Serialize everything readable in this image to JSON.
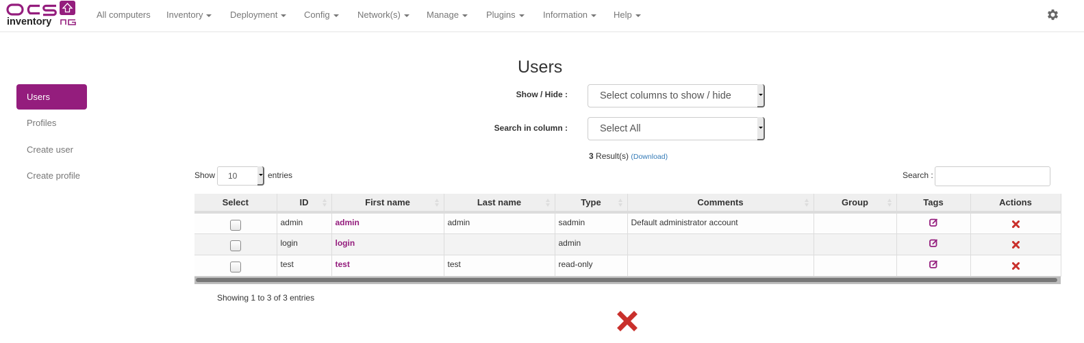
{
  "navbar": {
    "logo": {
      "top_text": "OCS",
      "bottom_text": "inventory",
      "suffix": "NG",
      "brand_color": "#941d7d"
    },
    "items": [
      {
        "label": "All computers",
        "dropdown": false
      },
      {
        "label": "Inventory",
        "dropdown": true
      },
      {
        "label": "Deployment",
        "dropdown": true
      },
      {
        "label": "Config",
        "dropdown": true
      },
      {
        "label": "Network(s)",
        "dropdown": true
      },
      {
        "label": "Manage",
        "dropdown": true
      },
      {
        "label": "Plugins",
        "dropdown": true
      },
      {
        "label": "Information",
        "dropdown": true
      },
      {
        "label": "Help",
        "dropdown": true
      }
    ],
    "settings_icon": "gear-icon"
  },
  "sidebar": {
    "items": [
      {
        "label": "Users",
        "active": true
      },
      {
        "label": "Profiles",
        "active": false
      },
      {
        "label": "Create user",
        "active": false
      },
      {
        "label": "Create profile",
        "active": false
      }
    ]
  },
  "main": {
    "title": "Users",
    "show_hide": {
      "label": "Show / Hide :",
      "value": "Select columns to show / hide"
    },
    "search_in_column": {
      "label": "Search in column :",
      "value": "Select All"
    },
    "results": {
      "count": "3",
      "label": "Result(s)",
      "download": "(Download)"
    },
    "length": {
      "show": "Show",
      "value": "10",
      "entries": "entries"
    },
    "search": {
      "label": "Search :",
      "value": "",
      "placeholder": ""
    },
    "table": {
      "columns": [
        "Select",
        "ID",
        "First name",
        "Last name",
        "Type",
        "Comments",
        "Group",
        "Tags",
        "Actions"
      ],
      "rows": [
        {
          "id": "admin",
          "first_name": "admin",
          "last_name": "admin",
          "type": "sadmin",
          "comments": "Default administrator account",
          "group": ""
        },
        {
          "id": "login",
          "first_name": "login",
          "last_name": "",
          "type": "admin",
          "comments": "",
          "group": ""
        },
        {
          "id": "test",
          "first_name": "test",
          "last_name": "test",
          "type": "read-only",
          "comments": "",
          "group": ""
        }
      ]
    },
    "info": "Showing 1 to 3 of 3 entries"
  },
  "colors": {
    "accent": "#941d7d",
    "delete": "#c9302c",
    "link": "#337ab7"
  }
}
